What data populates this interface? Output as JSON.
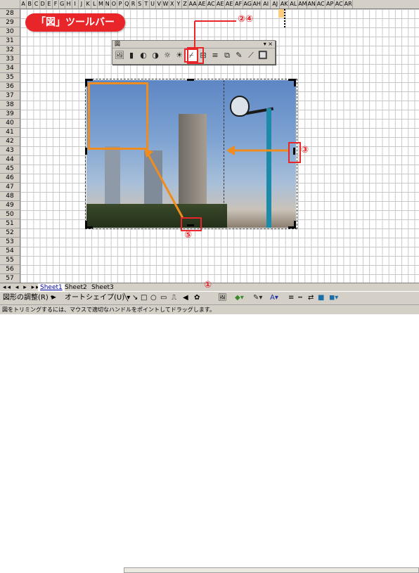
{
  "columns": [
    "A",
    "B",
    "C",
    "D",
    "E",
    "F",
    "G",
    "H",
    "I",
    "J",
    "K",
    "L",
    "M",
    "N",
    "O",
    "P",
    "Q",
    "R",
    "S",
    "T",
    "U",
    "V",
    "W",
    "X",
    "Y",
    "Z",
    "AA",
    "AE",
    "AC",
    "AE",
    "AE",
    "AF",
    "AG",
    "AH",
    "AI",
    "AJ",
    "AK",
    "AL",
    "AM",
    "AN",
    "AC",
    "AP",
    "AC",
    "AR"
  ],
  "rows": [
    "28",
    "29",
    "30",
    "31",
    "32",
    "33",
    "34",
    "35",
    "36",
    "37",
    "38",
    "39",
    "40",
    "41",
    "42",
    "43",
    "44",
    "45",
    "46",
    "47",
    "48",
    "49",
    "50",
    "51",
    "52",
    "53",
    "54",
    "55",
    "56",
    "57"
  ],
  "callout": {
    "text": "「図」ツールバー"
  },
  "picture_toolbar": {
    "title": "図",
    "title_buttons": "▾ ×",
    "tools": [
      "🖼",
      "▮",
      "◐",
      "◑",
      "☼",
      "☀",
      "⌿",
      "⊞",
      "≡",
      "⧉",
      "✎",
      "⟋",
      "🔲"
    ]
  },
  "annotations": {
    "n24": "②④",
    "n3": "③",
    "n5": "⑤",
    "n1": "①"
  },
  "sheet_tabs": {
    "nav": "◂◂ ◂ ▸ ▸▸",
    "tabs": [
      "Sheet1",
      "Sheet2",
      "Sheet3"
    ]
  },
  "drawing_toolbar": {
    "adjust": "図形の調整(R) ▾",
    "autoshape": "オートシェイプ(U) ▾",
    "icons": [
      "╲",
      "↘",
      "□",
      "○",
      "▭",
      "⎍",
      "◀",
      "✿",
      "🖼"
    ]
  },
  "status_bar": {
    "text": "図をトリミングするには、マウスで適切なハンドルをポイントしてドラッグします。"
  },
  "colors": {
    "accent_red": "#e8262a",
    "accent_orange": "#f08c1e"
  }
}
